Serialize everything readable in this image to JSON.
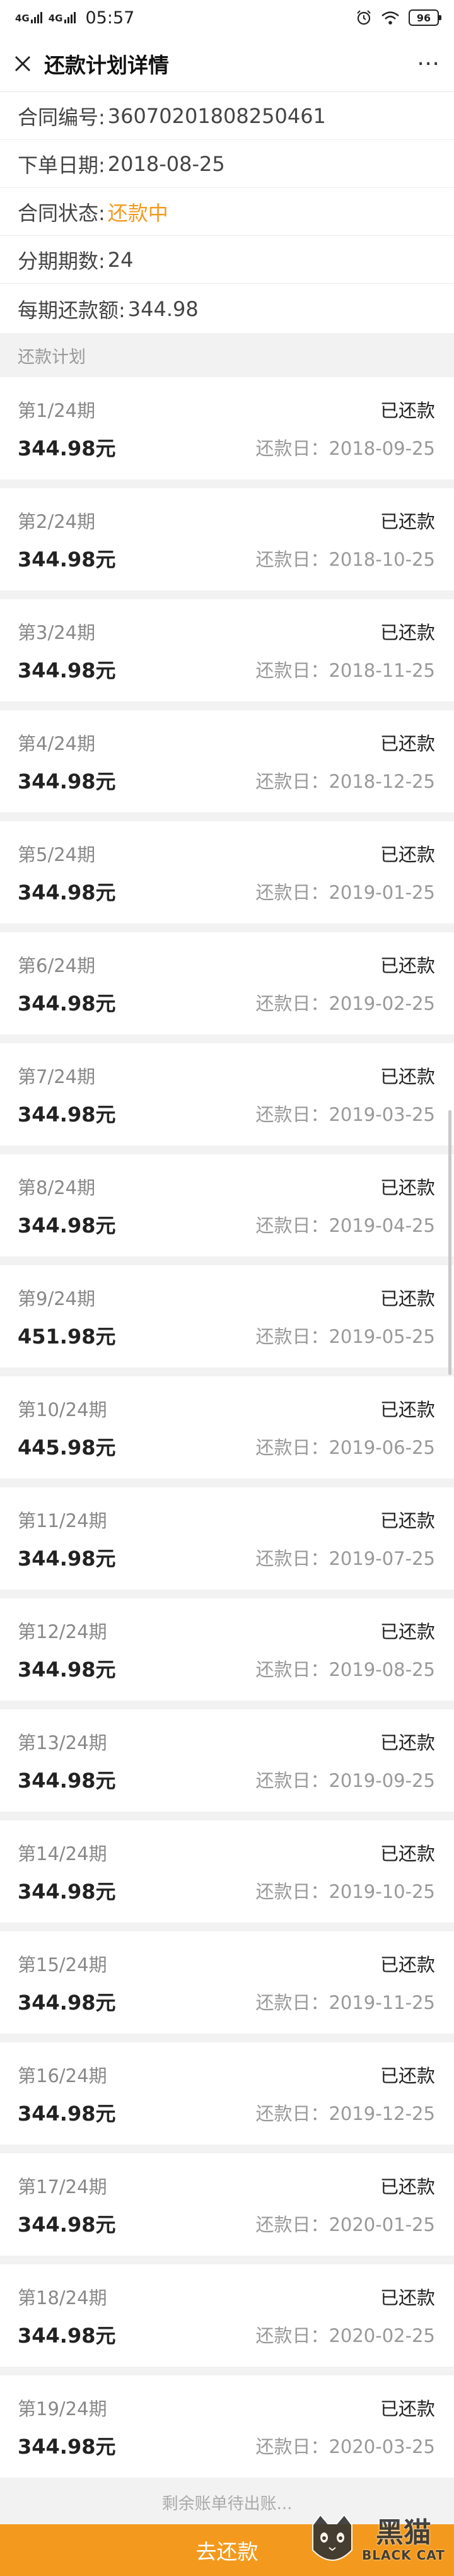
{
  "status_bar": {
    "signal_1": "4G",
    "signal_2": "4G",
    "time": "05:57",
    "battery": "96",
    "icons": [
      "alarm-icon",
      "wifi-icon",
      "battery-icon"
    ]
  },
  "nav": {
    "title": "还款计划详情",
    "close_icon": "close-icon",
    "more_icon": "more-icon",
    "more_glyph": "⋯"
  },
  "contract": {
    "number_label": "合同编号:",
    "number": "36070201808250461",
    "order_date_label": "下单日期:",
    "order_date": "2018-08-25",
    "status_label": "合同状态:",
    "status": "还款中",
    "periods_label": "分期期数:",
    "periods": "24",
    "per_payment_label": "每期还款额:",
    "per_payment": "344.98"
  },
  "plan_section_title": "还款计划",
  "plans": [
    {
      "period": "第1/24期",
      "status": "已还款",
      "amount": "344.98元",
      "due": "还款日：2018-09-25"
    },
    {
      "period": "第2/24期",
      "status": "已还款",
      "amount": "344.98元",
      "due": "还款日：2018-10-25"
    },
    {
      "period": "第3/24期",
      "status": "已还款",
      "amount": "344.98元",
      "due": "还款日：2018-11-25"
    },
    {
      "period": "第4/24期",
      "status": "已还款",
      "amount": "344.98元",
      "due": "还款日：2018-12-25"
    },
    {
      "period": "第5/24期",
      "status": "已还款",
      "amount": "344.98元",
      "due": "还款日：2019-01-25"
    },
    {
      "period": "第6/24期",
      "status": "已还款",
      "amount": "344.98元",
      "due": "还款日：2019-02-25"
    },
    {
      "period": "第7/24期",
      "status": "已还款",
      "amount": "344.98元",
      "due": "还款日：2019-03-25"
    },
    {
      "period": "第8/24期",
      "status": "已还款",
      "amount": "344.98元",
      "due": "还款日：2019-04-25"
    },
    {
      "period": "第9/24期",
      "status": "已还款",
      "amount": "451.98元",
      "due": "还款日：2019-05-25"
    },
    {
      "period": "第10/24期",
      "status": "已还款",
      "amount": "445.98元",
      "due": "还款日：2019-06-25"
    },
    {
      "period": "第11/24期",
      "status": "已还款",
      "amount": "344.98元",
      "due": "还款日：2019-07-25"
    },
    {
      "period": "第12/24期",
      "status": "已还款",
      "amount": "344.98元",
      "due": "还款日：2019-08-25"
    },
    {
      "period": "第13/24期",
      "status": "已还款",
      "amount": "344.98元",
      "due": "还款日：2019-09-25"
    },
    {
      "period": "第14/24期",
      "status": "已还款",
      "amount": "344.98元",
      "due": "还款日：2019-10-25"
    },
    {
      "period": "第15/24期",
      "status": "已还款",
      "amount": "344.98元",
      "due": "还款日：2019-11-25"
    },
    {
      "period": "第16/24期",
      "status": "已还款",
      "amount": "344.98元",
      "due": "还款日：2019-12-25"
    },
    {
      "period": "第17/24期",
      "status": "已还款",
      "amount": "344.98元",
      "due": "还款日：2020-01-25"
    },
    {
      "period": "第18/24期",
      "status": "已还款",
      "amount": "344.98元",
      "due": "还款日：2020-02-25"
    },
    {
      "period": "第19/24期",
      "status": "已还款",
      "amount": "344.98元",
      "due": "还款日：2020-03-25"
    }
  ],
  "remaining_text": "剩余账单待出账...",
  "bottom_button": "去还款",
  "watermark": {
    "cn": "黑猫",
    "en": "BLACK CAT"
  },
  "colors": {
    "accent": "#f39a1e",
    "background": "#f2f2f2"
  }
}
